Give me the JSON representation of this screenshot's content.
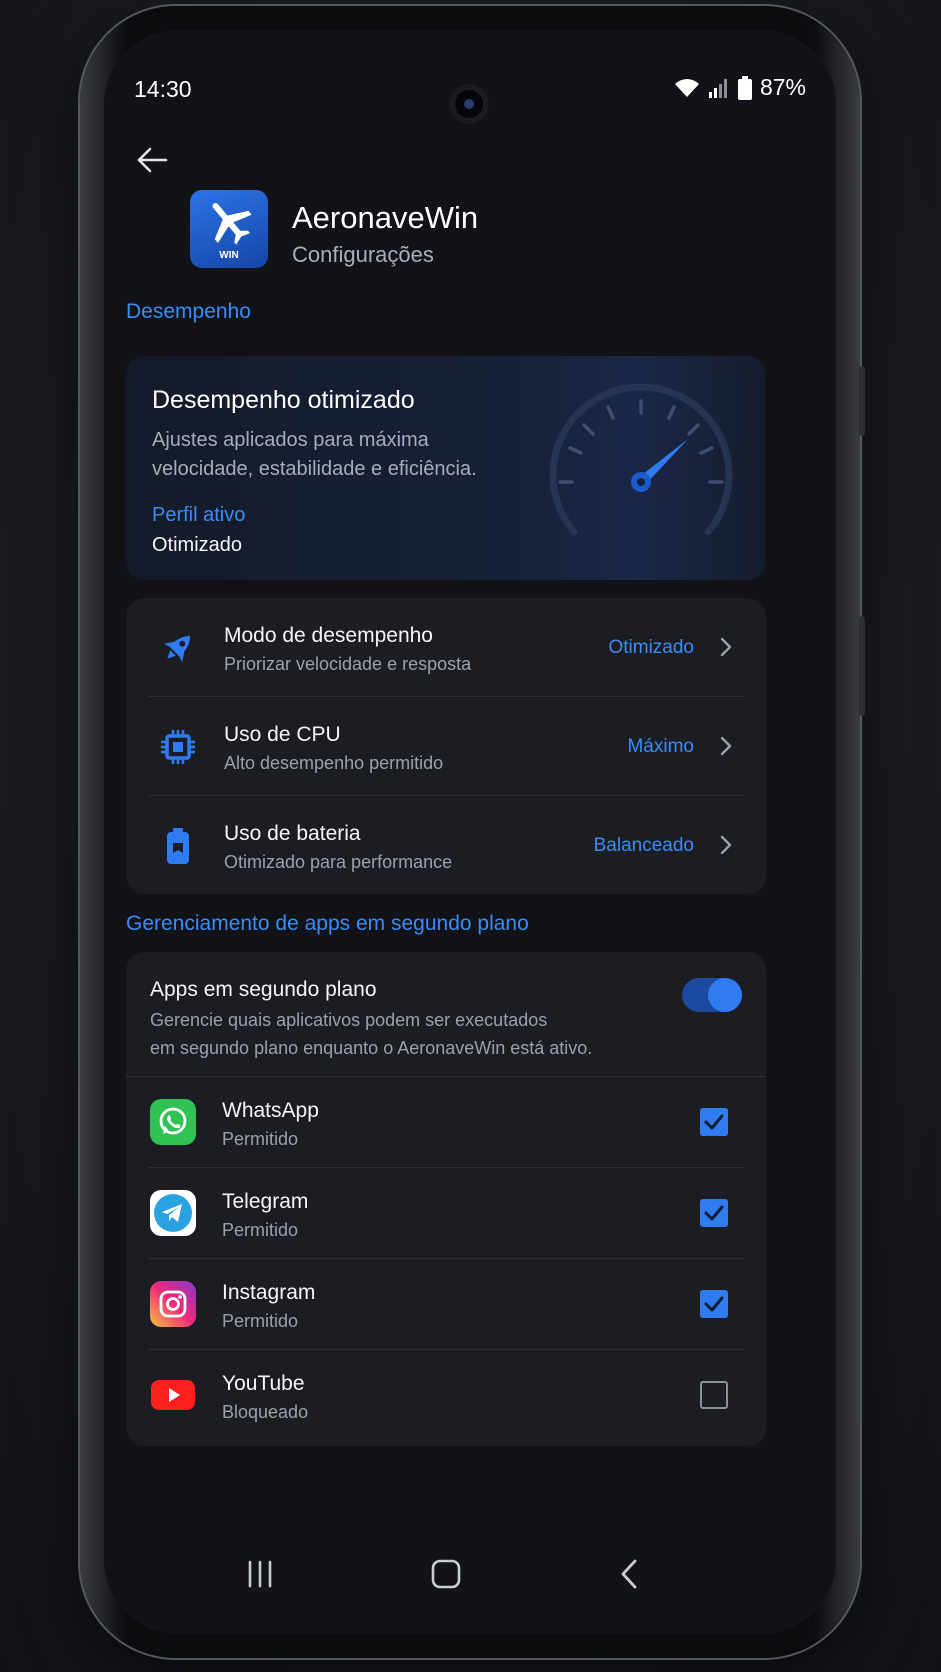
{
  "status_bar": {
    "time": "14:30",
    "battery": "87%"
  },
  "header": {
    "app_name": "AeronaveWin",
    "subtitle": "Configurações",
    "logo_text": "WIN"
  },
  "performance": {
    "section_title": "Desempenho",
    "hero": {
      "title": "Desempenho otimizado",
      "description": "Ajustes aplicados para máxima velocidade, estabilidade e eficiência.",
      "profile_label": "Perfil ativo",
      "profile_value": "Otimizado"
    },
    "settings": [
      {
        "title": "Modo de desempenho",
        "subtitle": "Priorizar velocidade e resposta",
        "value": "Otimizado",
        "icon": "rocket-icon"
      },
      {
        "title": "Uso de CPU",
        "subtitle": "Alto desempenho permitido",
        "value": "Máximo",
        "icon": "cpu-icon"
      },
      {
        "title": "Uso de bateria",
        "subtitle": "Otimizado para performance",
        "value": "Balanceado",
        "icon": "battery-icon"
      }
    ]
  },
  "background_apps": {
    "section_title": "Gerenciamento de apps em segundo plano",
    "toggle_title": "Apps em segundo plano",
    "toggle_desc_line1": "Gerencie quais aplicativos podem ser executados",
    "toggle_desc_line2": "em segundo plano enquanto o AeronaveWin está ativo.",
    "toggle_on": true,
    "apps": [
      {
        "name": "WhatsApp",
        "status": "Permitido",
        "checked": true,
        "icon": "whatsapp-icon"
      },
      {
        "name": "Telegram",
        "status": "Permitido",
        "checked": true,
        "icon": "telegram-icon"
      },
      {
        "name": "Instagram",
        "status": "Permitido",
        "checked": true,
        "icon": "instagram-icon"
      },
      {
        "name": "YouTube",
        "status": "Bloqueado",
        "checked": false,
        "icon": "youtube-icon"
      }
    ]
  },
  "colors": {
    "accent": "#3b8cf5",
    "background": "#111318",
    "card": "#1b1d23"
  }
}
